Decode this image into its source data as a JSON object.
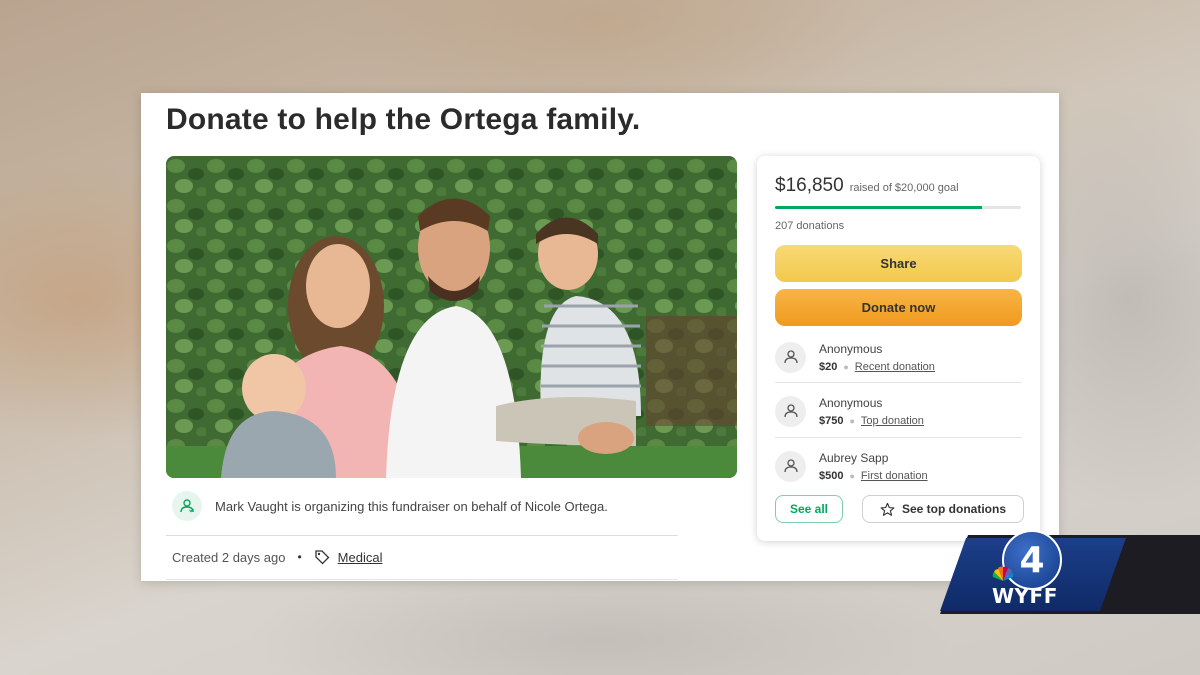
{
  "page": {
    "title": "Donate to help the Ortega family."
  },
  "organizer": {
    "text": "Mark Vaught is organizing this fundraiser on behalf of Nicole Ortega."
  },
  "meta": {
    "created": "Created 2 days ago",
    "separator": "•",
    "category": "Medical"
  },
  "donation_panel": {
    "raised": "$16,850",
    "goal_text": "raised of $20,000 goal",
    "progress_fraction": 0.8425,
    "donation_count": "207 donations",
    "share_label": "Share",
    "donate_label": "Donate now",
    "accent_color": "#02a95c",
    "donors": [
      {
        "name": "Anonymous",
        "amount": "$20",
        "type": "Recent donation"
      },
      {
        "name": "Anonymous",
        "amount": "$750",
        "type": "Top donation"
      },
      {
        "name": "Aubrey Sapp",
        "amount": "$500",
        "type": "First donation"
      }
    ],
    "see_all_label": "See all",
    "see_top_label": "See top donations"
  },
  "broadcast": {
    "channel_number": "4",
    "call_sign": "WYFF"
  }
}
